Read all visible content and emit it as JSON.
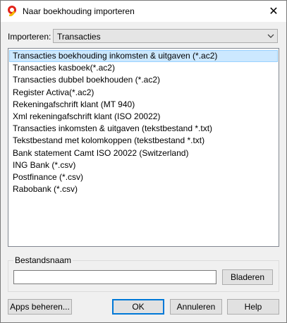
{
  "window": {
    "title": "Naar boekhouding importeren",
    "close_glyph": "✕"
  },
  "import": {
    "label": "Importeren:",
    "selected": "Transacties"
  },
  "list": {
    "selected_index": 0,
    "items": [
      "Transacties boekhouding inkomsten & uitgaven (*.ac2)",
      "Transacties kasboek(*.ac2)",
      "Transacties dubbel boekhouden (*.ac2)",
      "Register Activa(*.ac2)",
      "Rekeningafschrift klant (MT 940)",
      "Xml rekeningafschrift klant (ISO 20022)",
      "Transacties inkomsten & uitgaven (tekstbestand *.txt)",
      "Tekstbestand met kolomkoppen (tekstbestand *.txt)",
      "Bank statement Camt ISO 20022 (Switzerland)",
      "ING Bank (*.csv)",
      "Postfinance (*.csv)",
      "Rabobank (*.csv)"
    ]
  },
  "file": {
    "group_label": "Bestandsnaam",
    "value": "",
    "browse_label": "Bladeren"
  },
  "footer": {
    "apps_label": "Apps beheren...",
    "ok_label": "OK",
    "cancel_label": "Annuleren",
    "help_label": "Help"
  },
  "colors": {
    "accent": "#0078d7",
    "selection": "#cce8ff",
    "app_icon_red": "#e2231a",
    "app_icon_yellow": "#f5b800"
  },
  "icons": {
    "app": "banana-app-icon",
    "close": "close-icon",
    "dropdown": "chevron-down-icon"
  }
}
